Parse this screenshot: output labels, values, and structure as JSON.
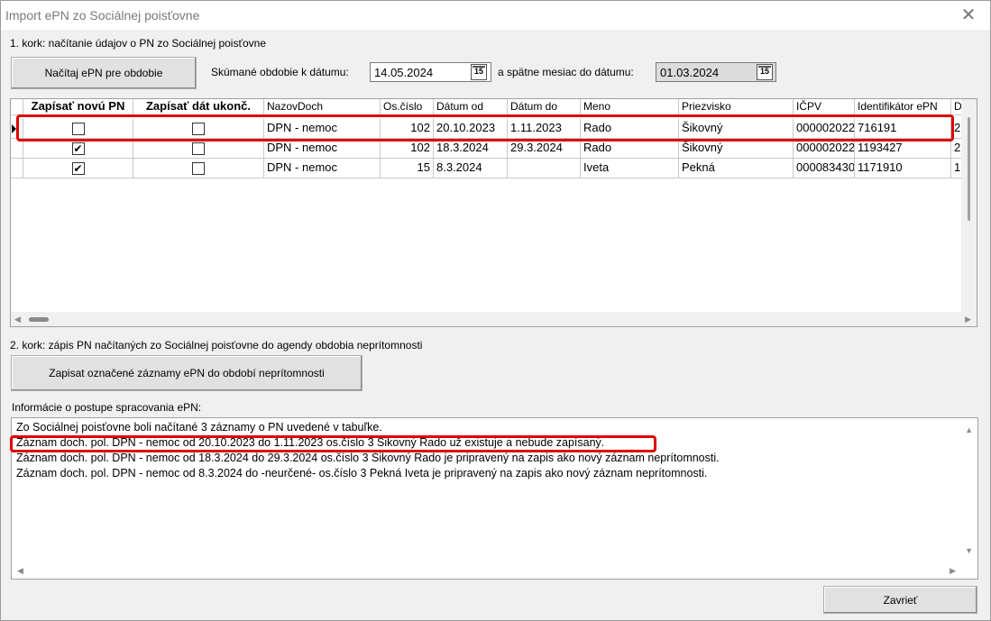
{
  "window": {
    "title": "Import ePN zo Sociálnej poisťovne",
    "close_glyph": "✕"
  },
  "step1": {
    "label": "1. kork: načítanie údajov o PN zo Sociálnej poisťovne",
    "load_button": "Načítaj ePN pre obdobie",
    "date_label": "Skúmané obdobie k dátumu:",
    "date_value": "14.05.2024",
    "back_label": "a spätne mesiac do dátumu:",
    "back_value": "01.03.2024",
    "cal_glyph": "15"
  },
  "grid": {
    "headers": [
      "Zapísať novú PN",
      "Zapísať dát ukonč.",
      "NazovDoch",
      "Os.číslo",
      "Dátum od",
      "Dátum do",
      "Meno",
      "Priezvisko",
      "IČPV",
      "Identifikátor ePN",
      "D"
    ],
    "rows": [
      {
        "new": false,
        "end": false,
        "doch": "DPN - nemoc",
        "os": "102",
        "od": "20.10.2023",
        "do": "1.11.2023",
        "meno": "Rado",
        "priezvisko": "Šikovný",
        "icpv": "000002022",
        "id": "716191",
        "d": "2"
      },
      {
        "new": true,
        "end": false,
        "doch": "DPN - nemoc",
        "os": "102",
        "od": "18.3.2024",
        "do": "29.3.2024",
        "meno": "Rado",
        "priezvisko": "Šikovný",
        "icpv": "000002022",
        "id": "1193427",
        "d": "2"
      },
      {
        "new": true,
        "end": false,
        "doch": "DPN - nemoc",
        "os": "15",
        "od": "8.3.2024",
        "do": "",
        "meno": "Iveta",
        "priezvisko": "Pekná",
        "icpv": "000083430",
        "id": "1171910",
        "d": "1"
      }
    ]
  },
  "step2": {
    "label": "2. kork: zápis PN načítaných zo Sociálnej poisťovne do agendy obdobia neprítomnosti",
    "write_button": "Zapisat označené záznamy ePN do období neprítomnosti"
  },
  "info": {
    "label": "Informácie o postupe spracovania ePN:",
    "lines": [
      "Zo Sociálnej poisťovne boli načítané 3 záznamy o PN uvedené v tabuľke.",
      "Záznam doch. pol. DPN - nemoc od 20.10.2023 do 1.11.2023 os.číslo 3 Šikovný Rado už existuje a nebude zapísaný.",
      "Záznam doch. pol. DPN - nemoc od 18.3.2024 do 29.3.2024 os.číslo 3 Šikovný Rado je pripravený na zapis ako nový záznam neprítomnosti.",
      "Záznam doch. pol. DPN - nemoc od 8.3.2024 do -neurčené- os.číslo 3 Pekná Iveta je pripravený na zapis ako nový záznam neprítomnosti."
    ]
  },
  "close_button": "Zavrieť",
  "highlight_color": "#dd0000"
}
